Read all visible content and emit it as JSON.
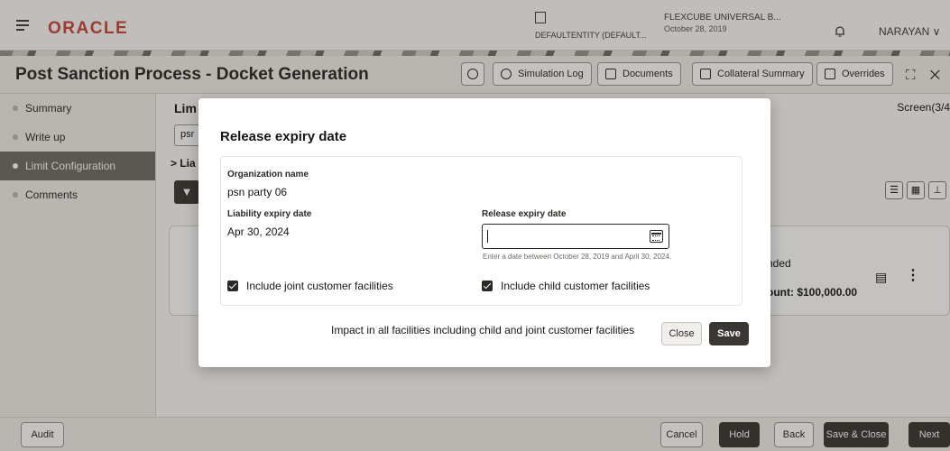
{
  "header": {
    "logo": "ORACLE",
    "entity": "DEFAULTENTITY (DEFAULT...",
    "branch_title": "FLEXCUBE UNIVERSAL B...",
    "branch_date": "October 28, 2019",
    "user": "NARAYAN ∨"
  },
  "titlebar": {
    "title": "Post Sanction Process - Docket Generation",
    "buttons": [
      "Simulation Log",
      "Documents",
      "Collateral Summary",
      "Overrides"
    ],
    "window_icons": "⛶ ✕"
  },
  "sidebar": {
    "items": [
      {
        "label": "Summary"
      },
      {
        "label": "Write up"
      },
      {
        "label": "Limit Configuration"
      },
      {
        "label": "Comments"
      }
    ]
  },
  "main": {
    "heading": "Lim",
    "screen": "Screen(3/4",
    "party_field": "psr",
    "liability_toggle": "> Lia",
    "filter_icon": "filter-icon",
    "card": {
      "status_text": "nded",
      "amount_text": "ount: $100,000.00"
    }
  },
  "footer": {
    "audit": "Audit",
    "cancel": "Cancel",
    "hold": "Hold",
    "back": "Back",
    "save_close": "Save & Close",
    "next": "Next"
  },
  "modal": {
    "title": "Release expiry date",
    "org_label": "Organization name",
    "org_value": "psn party 06",
    "liab_label": "Liability expiry date",
    "liab_value": "Apr 30, 2024",
    "release_label": "Release expiry date",
    "release_value": "",
    "hint": "Enter a date between October 28, 2019 and April 30, 2024.",
    "joint_label": "Include joint customer facilities",
    "joint_checked": true,
    "child_label": "Include child customer facilities",
    "child_checked": true,
    "impact": "Impact in all facilities including child and joint customer facilities",
    "close": "Close",
    "save": "Save"
  }
}
